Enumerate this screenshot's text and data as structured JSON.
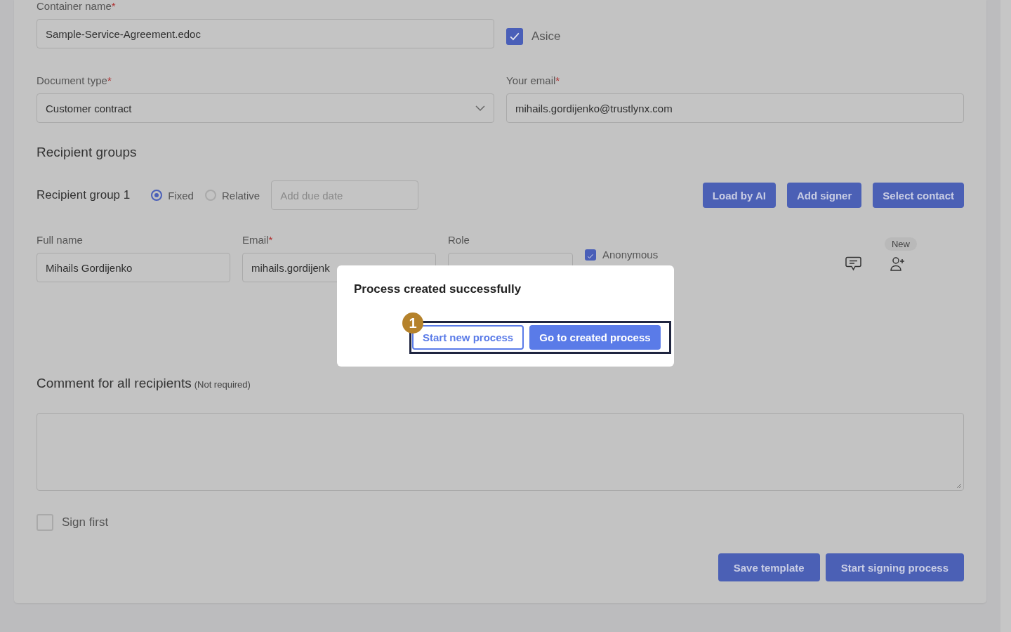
{
  "form": {
    "container_name": {
      "label": "Container name",
      "mark": "*",
      "value": "Sample-Service-Agreement.edoc"
    },
    "asice": {
      "label": "Asice",
      "checked": true
    },
    "document_type": {
      "label": "Document type",
      "mark": "*",
      "value": "Customer contract"
    },
    "your_email": {
      "label": "Your email",
      "mark": "*",
      "value": "mihails.gordijenko@trustlynx.com"
    }
  },
  "recipient_groups": {
    "title": "Recipient groups",
    "groups": [
      {
        "label": "Recipient group 1",
        "modes": [
          {
            "label": "Fixed",
            "selected": true
          },
          {
            "label": "Relative",
            "selected": false
          }
        ],
        "due_date": {
          "placeholder": "Add due date"
        },
        "buttons": [
          "Load by AI",
          "Add signer",
          "Select contact"
        ],
        "signers": [
          {
            "full_name": {
              "label": "Full name",
              "value": "Mihails Gordijenko"
            },
            "email": {
              "label": "Email",
              "mark": "*",
              "value": "mihails.gordijenk"
            },
            "role": {
              "label": "Role"
            },
            "anonymous": {
              "label": "Anonymous",
              "checked": true
            },
            "badge": "New"
          }
        ]
      }
    ]
  },
  "comment": {
    "title": "Comment for all recipients",
    "note": "(Not required)"
  },
  "sign_first": {
    "label": "Sign first",
    "checked": false
  },
  "actions": [
    "Save template",
    "Start signing process"
  ],
  "dialog": {
    "title": "Process created successfully",
    "step": "1",
    "buttons": [
      {
        "label": "Start new process",
        "kind": "secondary"
      },
      {
        "label": "Go to created process",
        "kind": "primary"
      }
    ]
  }
}
